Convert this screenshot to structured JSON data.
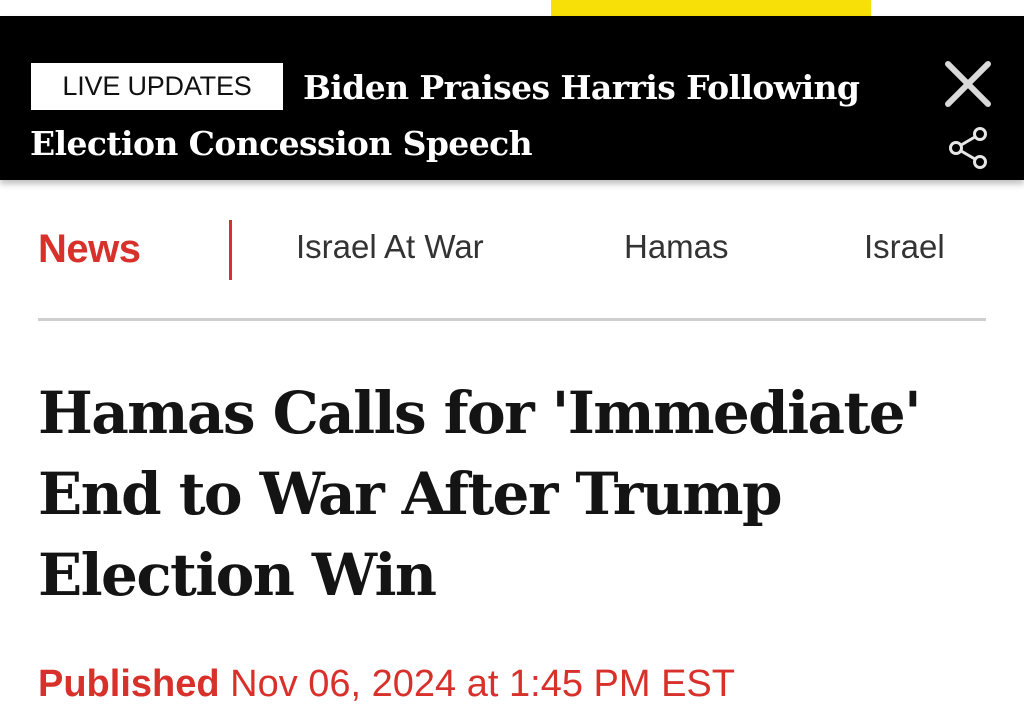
{
  "live_banner": {
    "badge": "LIVE UPDATES",
    "headline": "Biden Praises Harris Following Election Concession Speech",
    "close_icon": "close-icon",
    "share_icon": "share-icon"
  },
  "nav": {
    "active": "News",
    "links": [
      "Israel At War",
      "Hamas",
      "Israel"
    ]
  },
  "article": {
    "title": "Hamas Calls for 'Immediate' End to War After Trump Election Win",
    "published_label": "Published",
    "published_date": "Nov 06, 2024 at 1:45 PM EST"
  },
  "colors": {
    "accent_red": "#d8302a",
    "banner_black": "#000000",
    "tab_yellow": "#f7e008"
  }
}
